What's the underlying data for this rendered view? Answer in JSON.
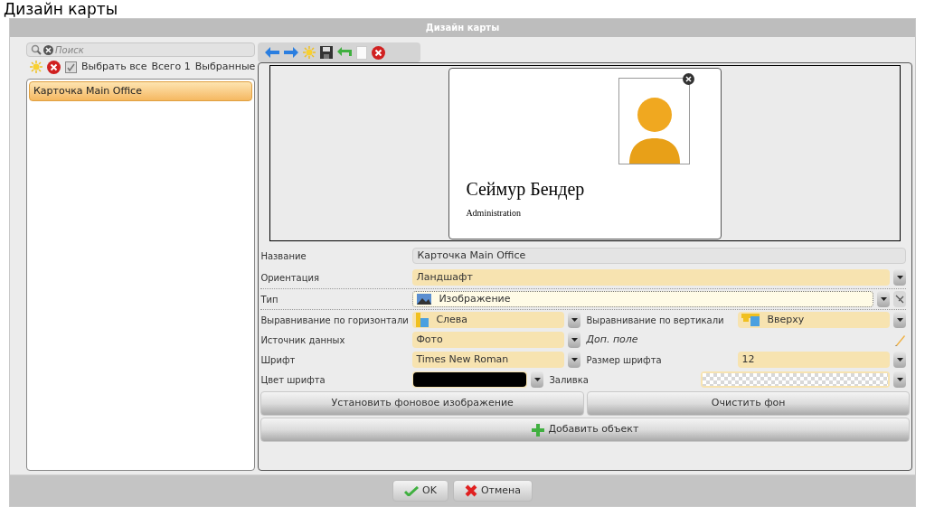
{
  "page_heading": "Дизайн карты",
  "window": {
    "title": "Дизайн карты"
  },
  "search": {
    "placeholder": "Поиск"
  },
  "list_toolbar": {
    "select_all": {
      "label": "Выбрать все",
      "checked": true
    },
    "total": "Всего 1",
    "selected_count": "Выбранные"
  },
  "cards": [
    {
      "label": "Карточка Main Office",
      "selected": true
    }
  ],
  "preview": {
    "name": "Сеймур Бендер",
    "department": "Administration"
  },
  "properties": [
    {
      "label": "Название",
      "value": "Карточка Main Office",
      "kind": "text",
      "focused": false
    },
    {
      "label": "Ориентация",
      "value": "Ландшафт",
      "kind": "select",
      "focused": false
    },
    {
      "label": "Тип",
      "value": "Изображение",
      "kind": "type_select",
      "focused": true
    }
  ],
  "paired_properties": [
    {
      "left": {
        "label": "Выравнивание по горизонтали",
        "value": "Слева",
        "kind": "halign_select"
      },
      "right": {
        "label": "Выравнивание по вертикали",
        "value": "Вверху",
        "kind": "valign_select"
      }
    },
    {
      "left": {
        "label": "Источник данных",
        "value": "Фото",
        "kind": "select"
      },
      "right": {
        "label": "Доп. поле",
        "kind": "edit_link"
      }
    },
    {
      "left": {
        "label": "Шрифт",
        "value": "Times New Roman",
        "kind": "select"
      },
      "right": {
        "label": "Размер шрифта",
        "value": "12",
        "kind": "select"
      }
    },
    {
      "left": {
        "label": "Цвет шрифта",
        "kind": "color",
        "color": "#000000"
      },
      "right": {
        "label": "Заливка",
        "kind": "pattern"
      }
    }
  ],
  "background_buttons": [
    "Установить фоновое изображение",
    "Очистить фон"
  ],
  "add_button": "Добавить объект",
  "dialog_buttons": [
    {
      "label": "OK",
      "kind": "ok"
    },
    {
      "label": "Отмена",
      "kind": "cancel"
    }
  ]
}
